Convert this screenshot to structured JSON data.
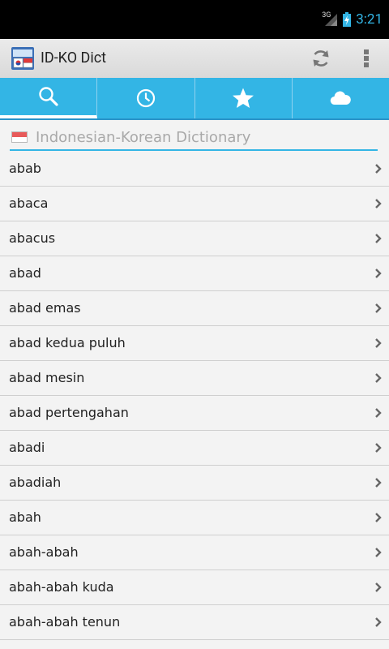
{
  "status": {
    "network": "3G",
    "time": "3:21"
  },
  "action_bar": {
    "title": "ID-KO Dict",
    "app_icon": "dictionary-flags-icon",
    "refresh_icon": "refresh-icon",
    "overflow_icon": "overflow-menu-icon"
  },
  "tabs": [
    {
      "icon": "search-icon",
      "selected": true
    },
    {
      "icon": "history-clock-icon",
      "selected": false
    },
    {
      "icon": "star-icon",
      "selected": false
    },
    {
      "icon": "cloud-icon",
      "selected": false
    }
  ],
  "search": {
    "placeholder": "Indonesian-Korean Dictionary",
    "value": ""
  },
  "words": [
    "abab",
    "abaca",
    "abacus",
    "abad",
    "abad emas",
    "abad kedua puluh",
    "abad mesin",
    "abad pertengahan",
    "abadi",
    "abadiah",
    "abah",
    "abah-abah",
    "abah-abah kuda",
    "abah-abah tenun"
  ],
  "colors": {
    "accent": "#33b5e5",
    "status_bar": "#000000",
    "action_bar": "#e2e2e2",
    "list_bg": "#f3f3f3"
  }
}
